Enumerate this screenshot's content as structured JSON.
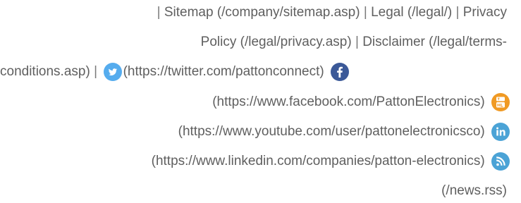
{
  "links": {
    "sitemap": "Sitemap (/company/sitemap.asp)",
    "legal": "Legal (/legal/)",
    "privacy_a": "Privacy",
    "privacy_b": "Policy (/legal/privacy.asp)",
    "disclaimer_a": "Disclaimer (/legal/terms-",
    "disclaimer_b": "conditions.asp)",
    "twitter": "(https://twitter.com/pattonconnect)",
    "facebook": "(https://www.facebook.com/PattonElectronics)",
    "youtube": "(https://www.youtube.com/user/pattonelectronicsco)",
    "linkedin": "(https://www.linkedin.com/companies/patton-electronics)",
    "rss": "(/news.rss)"
  },
  "separator": "|",
  "icons": {
    "twitter": "twitter-icon",
    "facebook": "facebook-icon",
    "youtube": "youtube-icon",
    "linkedin": "linkedin-icon",
    "rss": "rss-icon"
  },
  "colors": {
    "text": "#5f5f5f",
    "twitter": "#55acee",
    "facebook": "#3b5998",
    "youtube": "#f09a24",
    "linkedin": "#4ba3d6",
    "rss": "#4ba3d6"
  }
}
